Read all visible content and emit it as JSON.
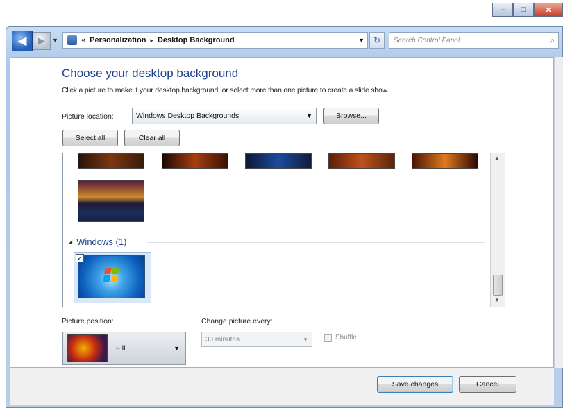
{
  "window": {
    "minimize": "–",
    "maximize": "□",
    "close": "✕"
  },
  "nav": {
    "back_icon": "arrow-left-icon",
    "forward_icon": "arrow-right-icon",
    "address_prefix": "«",
    "breadcrumb": [
      "Personalization",
      "Desktop Background"
    ],
    "breadcrumb_sep": "▸",
    "refresh_glyph": "↻",
    "search_placeholder": "Search Control Panel",
    "search_glyph": "⌕"
  },
  "main": {
    "title": "Choose your desktop background",
    "subtitle": "Click a picture to make it your desktop background, or select more than one picture to create a slide show.",
    "location_label": "Picture location:",
    "location_value": "Windows Desktop Backgrounds",
    "browse_label": "Browse...",
    "select_all_label": "Select all",
    "clear_all_label": "Clear all",
    "group_label": "Windows (1)",
    "group_collapse_glyph": "◢",
    "check_glyph": "✓"
  },
  "options": {
    "position_label": "Picture position:",
    "position_value": "Fill",
    "change_label": "Change picture every:",
    "change_value": "30 minutes",
    "shuffle_label": "Shuffle"
  },
  "footer": {
    "save_label": "Save changes",
    "cancel_label": "Cancel"
  }
}
